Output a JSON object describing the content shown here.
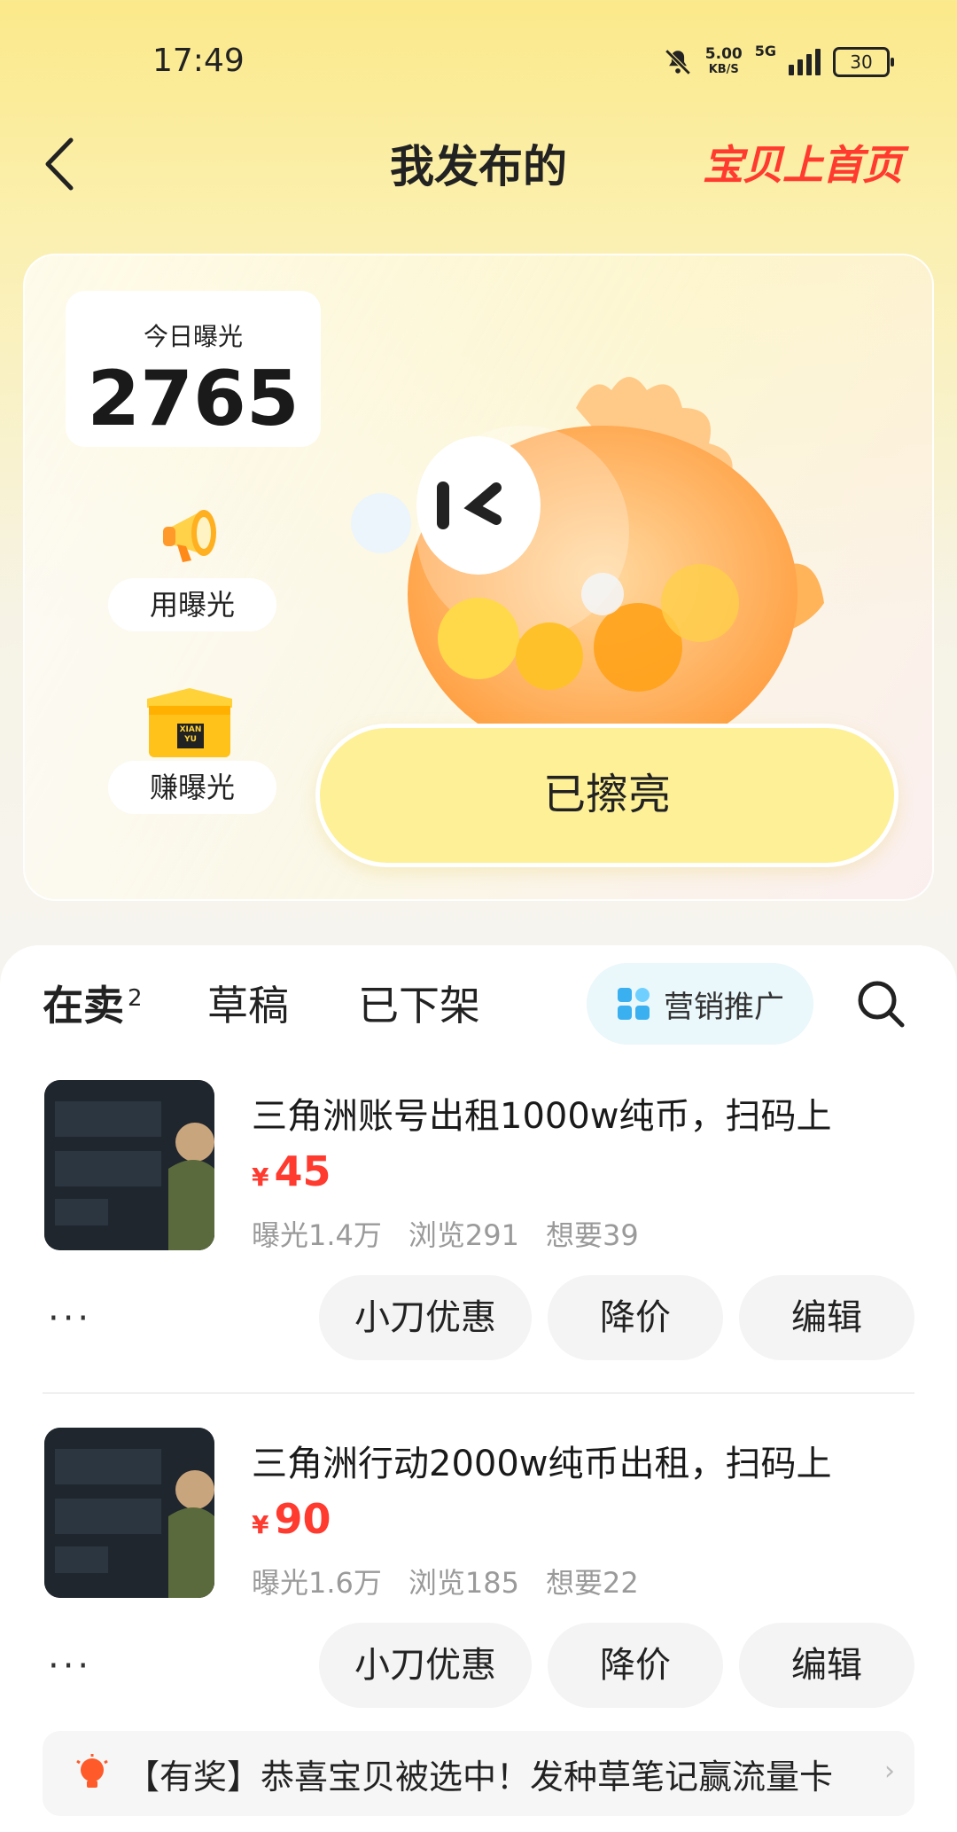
{
  "status_bar": {
    "time": "17:49",
    "speed_value": "5.00",
    "speed_unit": "KB/S",
    "network": "5G",
    "battery": "30"
  },
  "header": {
    "title": "我发布的",
    "home_link": "宝贝上首页"
  },
  "exposure": {
    "today_label": "今日曝光",
    "today_value": "2765",
    "use_label": "用曝光",
    "earn_label": "赚曝光",
    "box_text": "XIAN YU",
    "shine_button": "已擦亮"
  },
  "tabs": {
    "on_sale": "在卖",
    "on_sale_count": "2",
    "drafts": "草稿",
    "delisted": "已下架",
    "promo": "营销推广"
  },
  "listings": [
    {
      "title": "三角洲账号出租1000w纯币，扫码上",
      "currency": "¥",
      "price": "45",
      "exposure": "曝光1.4万",
      "views": "浏览291",
      "wants": "想要39",
      "more": "···",
      "action_discount": "小刀优惠",
      "action_reduce": "降价",
      "action_edit": "编辑"
    },
    {
      "title": "三角洲行动2000w纯币出租，扫码上",
      "currency": "¥",
      "price": "90",
      "exposure": "曝光1.6万",
      "views": "浏览185",
      "wants": "想要22",
      "more": "···",
      "action_discount": "小刀优惠",
      "action_reduce": "降价",
      "action_edit": "编辑"
    }
  ],
  "notice": {
    "text": "【有奖】恭喜宝贝被选中！发种草笔记赢流量卡",
    "chevron": "›"
  },
  "colors": {
    "accent_red": "#ff3a2f",
    "highlight_yellow": "#ffe14a",
    "shine_button": "#fdf097"
  }
}
